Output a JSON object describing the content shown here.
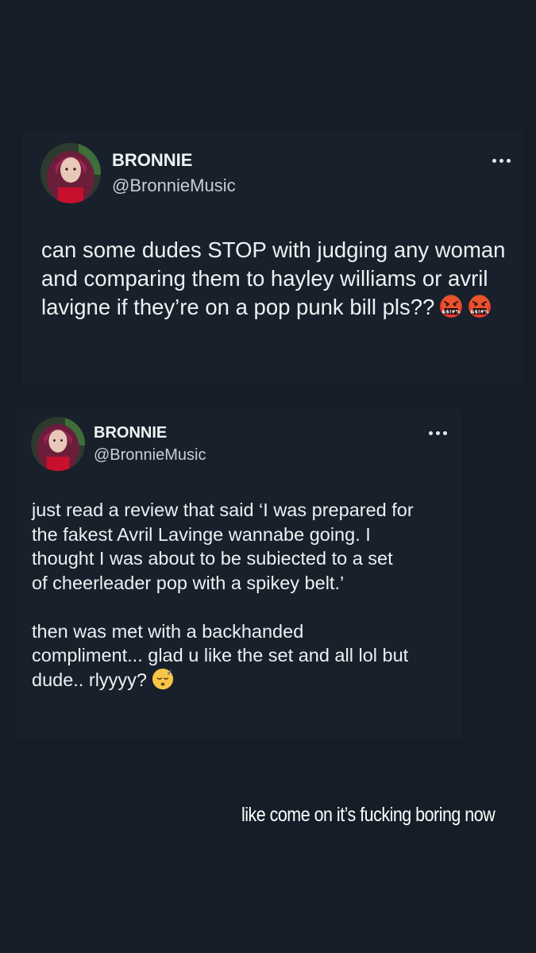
{
  "tweets": [
    {
      "display_name": "BRONNIE",
      "handle": "@BronnieMusic",
      "text": "can some dudes STOP with judging any woman and comparing them to hayley williams or avril lavigne if they’re on a pop punk bill pls??",
      "emojis": [
        "face-with-symbols-on-mouth-icon",
        "face-with-symbols-on-mouth-icon"
      ]
    },
    {
      "display_name": "BRONNIE",
      "handle": "@BronnieMusic",
      "text_para1": "just read a review that said ‘I was prepared for\nthe fakest Avril Lavinge wannabe going. I\nthought I was about to be subiected to a set\nof cheerleader pop with a spikey belt.’",
      "text_para2": "then was met with a backhanded\ncompliment... glad u like the set and all lol but\ndude.. rlyyyy?",
      "emojis": [
        "sleeping-face-icon"
      ]
    }
  ],
  "caption": "like come on it’s fucking boring now",
  "colors": {
    "background": "#151d28",
    "card": "#18202b",
    "text": "#eef0f2",
    "handle": "#c9ced4"
  }
}
